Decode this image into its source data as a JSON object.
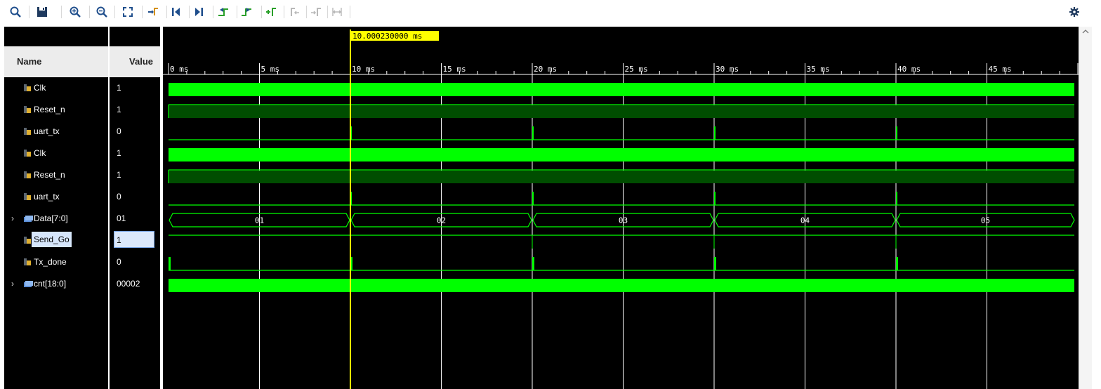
{
  "toolbar": {
    "buttons": [
      {
        "name": "search-icon"
      },
      {
        "name": "save-icon"
      },
      {
        "name": "zoom-in-icon"
      },
      {
        "name": "zoom-out-icon"
      },
      {
        "name": "zoom-fit-icon"
      },
      {
        "name": "go-to-cursor-icon"
      },
      {
        "name": "go-to-time-zero-icon"
      },
      {
        "name": "go-to-last-time-icon"
      },
      {
        "name": "previous-transition-icon"
      },
      {
        "name": "next-transition-icon"
      },
      {
        "name": "add-marker-icon"
      },
      {
        "name": "previous-marker-icon"
      },
      {
        "name": "next-marker-icon"
      },
      {
        "name": "swap-cursors-icon"
      }
    ],
    "settings_icon": "gear-icon"
  },
  "headers": {
    "name": "Name",
    "value": "Value"
  },
  "cursor": {
    "label": "10.000230000 ms",
    "time_ms": 10.00023,
    "color": "#ffff00"
  },
  "timeline": {
    "range_ms": [
      0,
      50
    ],
    "tick_labels": [
      "0 ms",
      "5 ms",
      "10 ms",
      "15 ms",
      "20 ms",
      "25 ms",
      "30 ms",
      "35 ms",
      "40 ms",
      "45 ms"
    ],
    "tick_values_ms": [
      0,
      5,
      10,
      15,
      20,
      25,
      30,
      35,
      40,
      45
    ]
  },
  "signals": [
    {
      "name": "Clk",
      "value": "1",
      "kind": "clock",
      "expandable": false,
      "selected": false
    },
    {
      "name": "Reset_n",
      "value": "1",
      "kind": "constant-high",
      "expandable": false,
      "selected": false
    },
    {
      "name": "uart_tx",
      "value": "0",
      "kind": "pulses",
      "pulses_ms": [
        10.0,
        20.0,
        30.0,
        40.0
      ],
      "expandable": false,
      "selected": false
    },
    {
      "name": "Clk",
      "value": "1",
      "kind": "clock",
      "expandable": false,
      "selected": false
    },
    {
      "name": "Reset_n",
      "value": "1",
      "kind": "constant-high",
      "expandable": false,
      "selected": false
    },
    {
      "name": "uart_tx",
      "value": "0",
      "kind": "pulses",
      "pulses_ms": [
        10.0,
        20.0,
        30.0,
        40.0
      ],
      "expandable": false,
      "selected": false
    },
    {
      "name": "Data[7:0]",
      "value": "01",
      "kind": "bus",
      "expandable": true,
      "selected": false,
      "segments": [
        {
          "from_ms": 0,
          "to_ms": 10,
          "label": "01"
        },
        {
          "from_ms": 10,
          "to_ms": 20,
          "label": "02"
        },
        {
          "from_ms": 20,
          "to_ms": 30,
          "label": "03"
        },
        {
          "from_ms": 30,
          "to_ms": 40,
          "label": "04"
        },
        {
          "from_ms": 40,
          "to_ms": 50,
          "label": "05"
        }
      ]
    },
    {
      "name": "Send_Go",
      "value": "1",
      "kind": "high-with-glitches",
      "pulses_ms": [
        10.0,
        20.0,
        30.0,
        40.0
      ],
      "expandable": false,
      "selected": true
    },
    {
      "name": "Tx_done",
      "value": "0",
      "kind": "pulses-wide",
      "pulses_ms": [
        0.0,
        10.0,
        20.0,
        30.0,
        40.0
      ],
      "expandable": false,
      "selected": false
    },
    {
      "name": "cnt[18:0]",
      "value": "00002",
      "kind": "dense-bus",
      "expandable": true,
      "selected": false
    }
  ],
  "colors": {
    "wave_green": "#00ff00",
    "wave_dark_green": "#004d00",
    "background": "#000000",
    "grid": "#ffffff",
    "cursor": "#ffff00"
  }
}
